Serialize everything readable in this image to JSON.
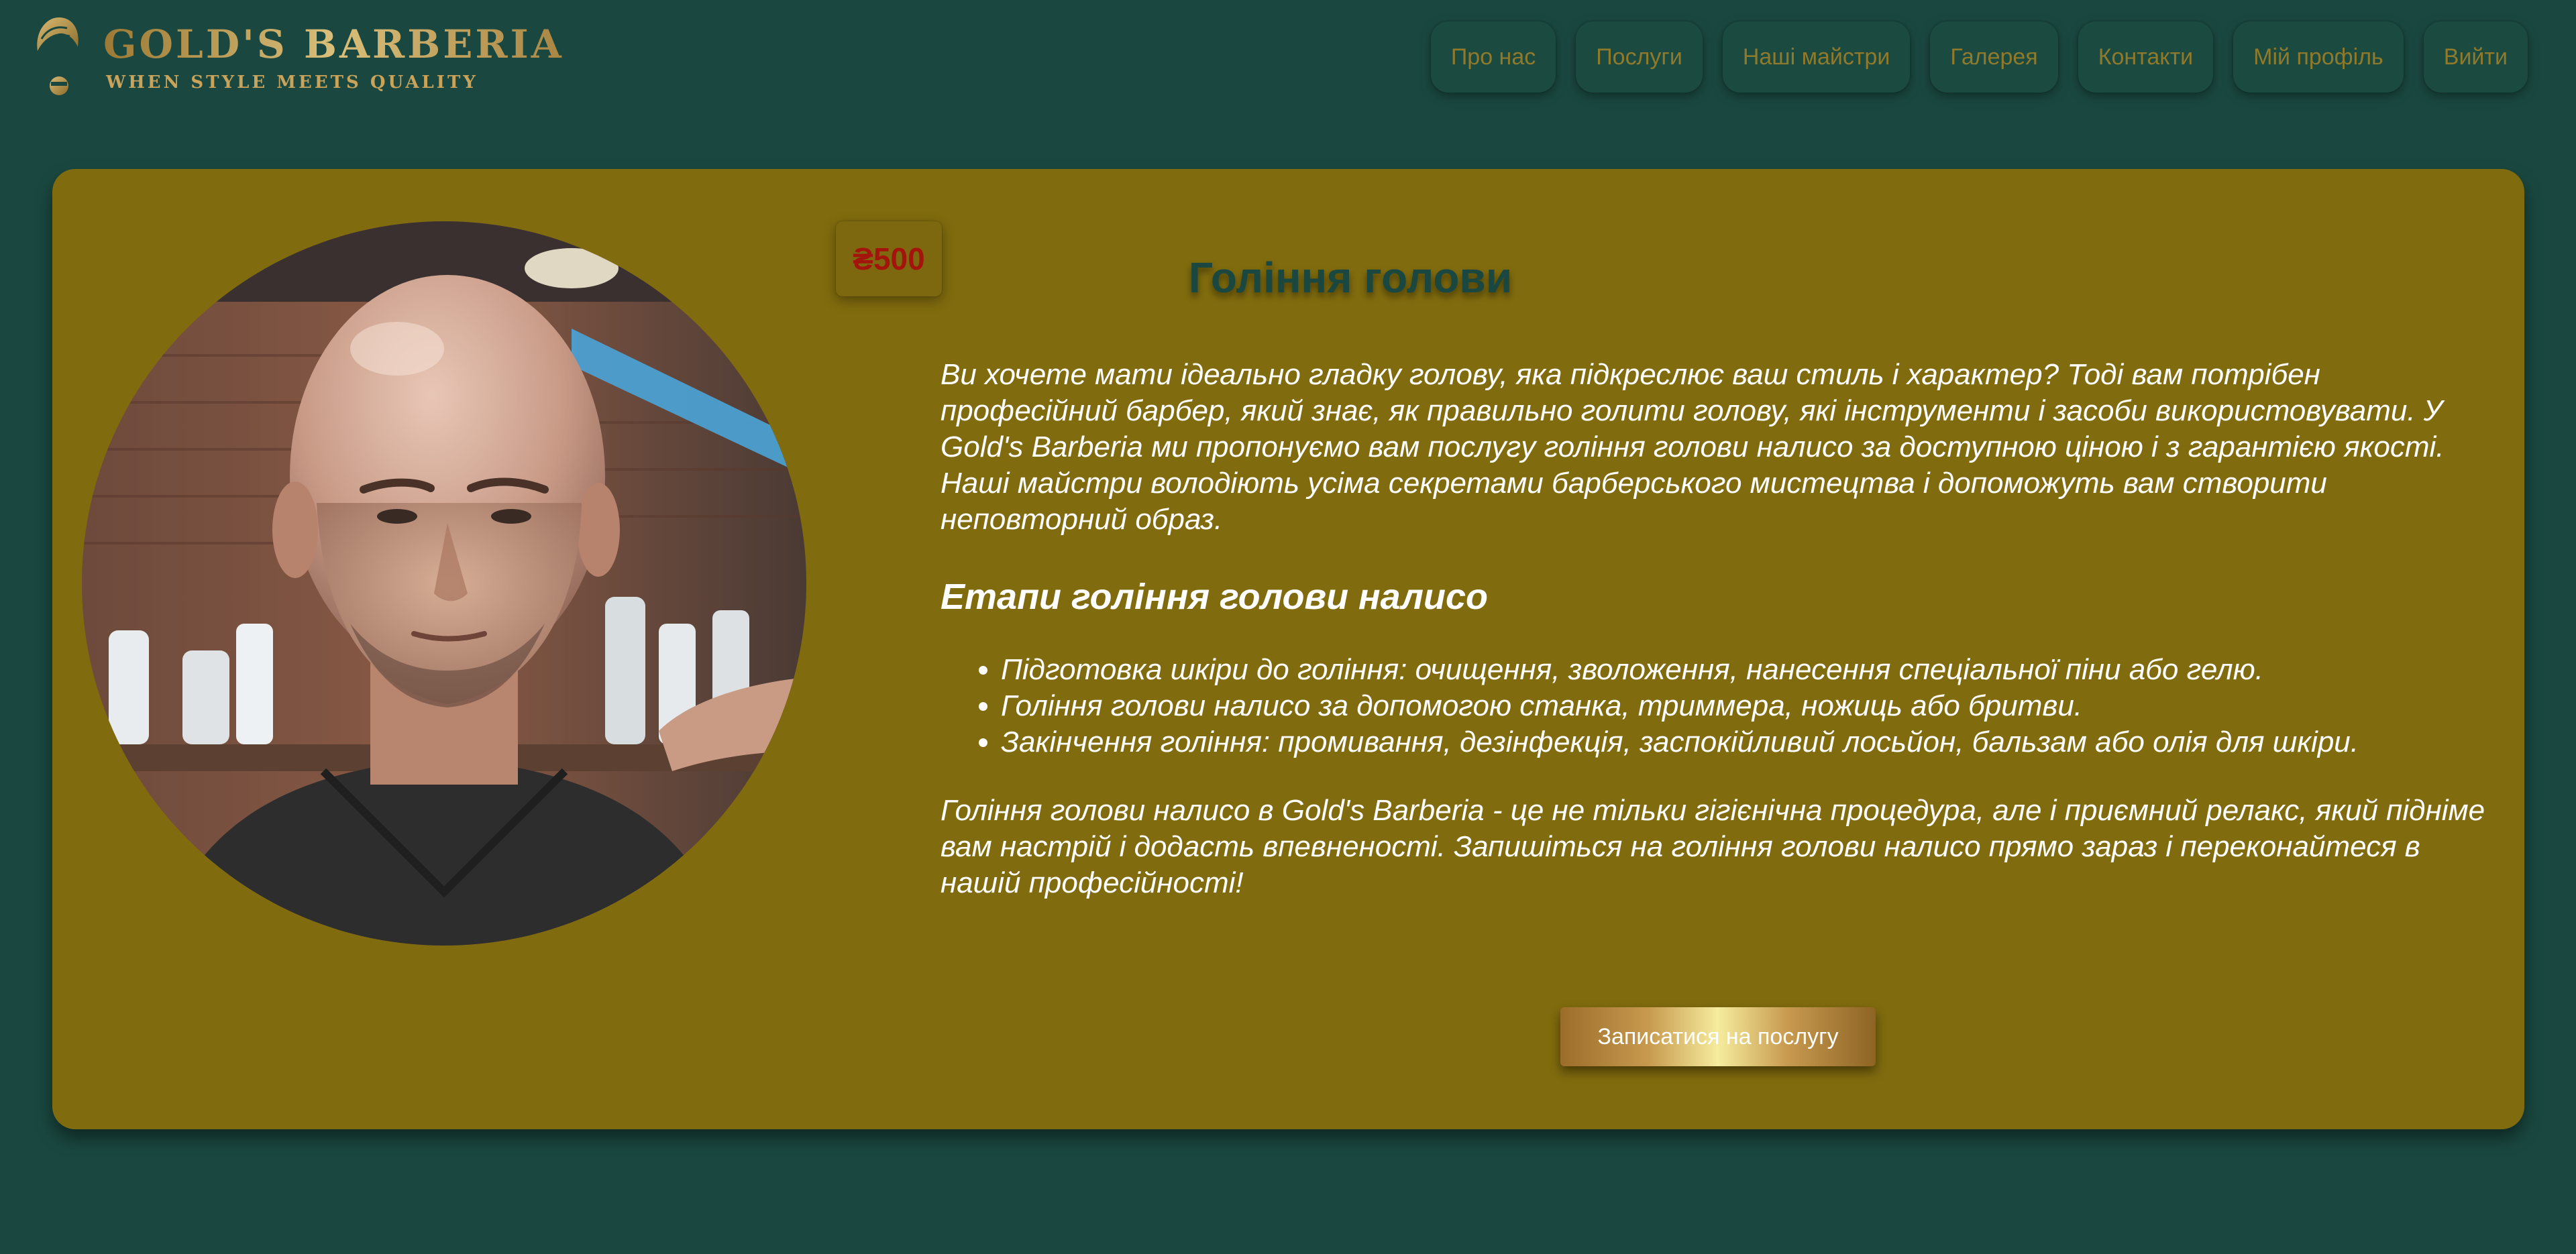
{
  "brand": {
    "name": "GOLD'S BARBERIA",
    "tagline": "WHEN STYLE MEETS QUALITY"
  },
  "nav": {
    "items": [
      {
        "label": "Про нас",
        "icon": "none"
      },
      {
        "label": "Послуги",
        "icon": "none"
      },
      {
        "label": "Наші майстри",
        "icon": "none"
      },
      {
        "label": "Галерея",
        "icon": "none"
      },
      {
        "label": "Контакти",
        "icon": "none"
      },
      {
        "label": "Мій профіль",
        "icon": "none"
      },
      {
        "label": "Вийти",
        "icon": "none"
      }
    ]
  },
  "service": {
    "price": "₴500",
    "title": "Гоління голови",
    "intro": "Ви хочете мати ідеально гладку голову, яка підкреслює ваш стиль і характер? Тоді вам потрібен професійний барбер, який знає, як правильно голити голову, які інструменти і засоби використовувати. У Gold's Barberia ми пропонуємо вам послугу гоління голови налисо за доступною ціною і з гарантією якості. Наші майстри володіють усіма секретами барберського мистецтва і допоможуть вам створити неповторний образ.",
    "stages_heading": "Етапи гоління голови налисо",
    "stages": [
      "Підготовка шкіри до гоління: очищення, зволоження, нанесення спеціальної піни або гелю.",
      "Гоління голови налисо за допомогою станка, триммера, ножиць або бритви.",
      "Закінчення гоління: промивання, дезінфекція, заспокійливий лосьйон, бальзам або олія для шкіри."
    ],
    "outro": "Гоління голови налисо в Gold's Barberia - це не тільки гігієнічна процедура, але і приємний релакс, який підніме вам настрій і додасть впевненості. Запишіться на гоління голови налисо прямо зараз і переконайтеся в нашій професійності!",
    "book_label": "Записатися на послугу"
  },
  "colors": {
    "background": "#1a4840",
    "card": "#806b0e",
    "nav_text": "#8f7a2c",
    "price": "#a3150c",
    "gold": "#c9a35a"
  }
}
